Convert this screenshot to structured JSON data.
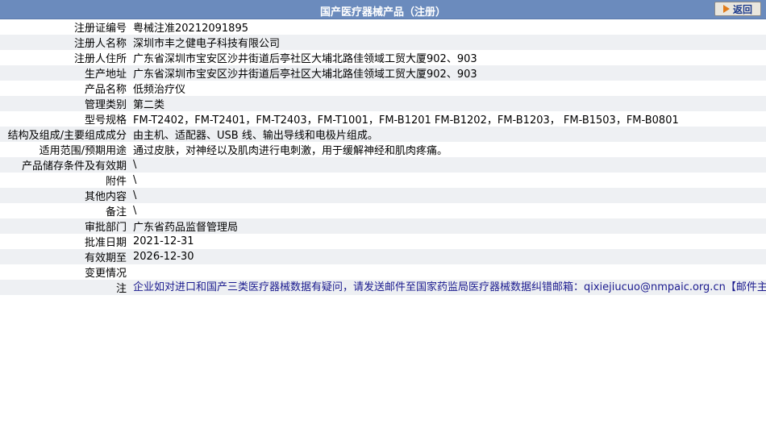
{
  "header": {
    "title": "国产医疗器械产品（注册）",
    "back_label": "返回"
  },
  "rows": [
    {
      "label": "注册证编号",
      "value": "粤械注准20212091895"
    },
    {
      "label": "注册人名称",
      "value": "深圳市丰之健电子科技有限公司"
    },
    {
      "label": "注册人住所",
      "value": "广东省深圳市宝安区沙井街道后亭社区大埔北路佳领域工贸大厦902、903"
    },
    {
      "label": "生产地址",
      "value": "广东省深圳市宝安区沙井街道后亭社区大埔北路佳领域工贸大厦902、903"
    },
    {
      "label": "产品名称",
      "value": "低频治疗仪"
    },
    {
      "label": "管理类别",
      "value": "第二类"
    },
    {
      "label": "型号规格",
      "value": "FM-T2402，FM-T2401，FM-T2403，FM-T1001，FM-B1201 FM-B1202，FM-B1203， FM-B1503，FM-B0801"
    },
    {
      "label": "结构及组成/主要组成成分",
      "value": "由主机、适配器、USB 线、输出导线和电极片组成。"
    },
    {
      "label": "适用范围/预期用途",
      "value": "通过皮肤，对神经以及肌肉进行电刺激，用于缓解神经和肌肉疼痛。"
    },
    {
      "label": "产品储存条件及有效期",
      "value": "\\"
    },
    {
      "label": "附件",
      "value": "\\"
    },
    {
      "label": "其他内容",
      "value": "\\"
    },
    {
      "label": "备注",
      "value": "\\"
    },
    {
      "label": "审批部门",
      "value": "广东省药品监督管理局"
    },
    {
      "label": "批准日期",
      "value": "2021-12-31"
    },
    {
      "label": "有效期至",
      "value": "2026-12-30"
    },
    {
      "label": "变更情况",
      "value": ""
    }
  ],
  "note": {
    "label": "注",
    "text": "企业如对进口和国产三类医疗器械数据有疑问，请发送邮件至国家药监局医疗器械数据纠错邮箱：qixiejiucuo@nmpaic.org.cn【邮件主题请注明“医疗器械数据问题”，邮件正文中请准确填写以下全部信息：1.医疗器械注册证号/备案号；2.类型（注册、变更、延续等）；3.问题描述（500字以内）；4.企业名称（全称）；5.统一社会信用代码；6.联系人姓名；7.联系电话（手机和座机）；8.联系邮箱】，或致电国家药监局医疗器械数据纠错电话010-88331514（此电话为我局医疗器械数据纠错联系电话，并非相应产品/企业业务咨询电话）。企业如对国产一类和二类医疗器械数据有疑问，请咨询国家局信息中心，电话010-88332877，88331520（工作日），也可通过发邮件与我们联系：邮件地址yaopinshuju@nmpaic.org.cn，邮件主题请注明“国产医疗器械产品（注册）-数据（注册证号/备案号）数据问题”。国产一类和二类医疗器械数据来源于省局，由省局通过数据共享平台进行纠错和维护。"
  }
}
